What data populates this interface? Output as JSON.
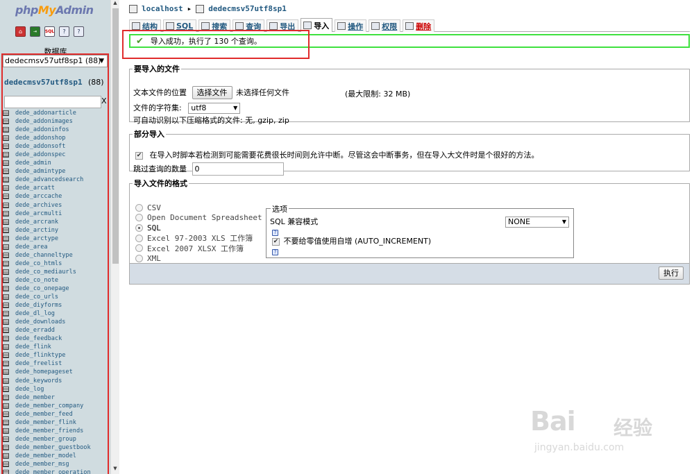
{
  "logo": {
    "php": "php",
    "my": "My",
    "admin": "Admin"
  },
  "nav_icons": [
    "home-icon",
    "sql-icon",
    "query-window-icon",
    "docs-icon",
    "mysql-docs-icon"
  ],
  "sidebar": {
    "caption": "数据库",
    "db_select_value": "dedecmsv57utf8sp1 (88)",
    "db_link": "dedecmsv57utf8sp1",
    "db_count": "(88)",
    "filter_clear": "X",
    "tables": [
      "dede_addonarticle",
      "dede_addonimages",
      "dede_addoninfos",
      "dede_addonshop",
      "dede_addonsoft",
      "dede_addonspec",
      "dede_admin",
      "dede_admintype",
      "dede_advancedsearch",
      "dede_arcatt",
      "dede_arccache",
      "dede_archives",
      "dede_arcmulti",
      "dede_arcrank",
      "dede_arctiny",
      "dede_arctype",
      "dede_area",
      "dede_channeltype",
      "dede_co_htmls",
      "dede_co_mediaurls",
      "dede_co_note",
      "dede_co_onepage",
      "dede_co_urls",
      "dede_diyforms",
      "dede_dl_log",
      "dede_downloads",
      "dede_erradd",
      "dede_feedback",
      "dede_flink",
      "dede_flinktype",
      "dede_freelist",
      "dede_homepageset",
      "dede_keywords",
      "dede_log",
      "dede_member",
      "dede_member_company",
      "dede_member_feed",
      "dede_member_flink",
      "dede_member_friends",
      "dede_member_group",
      "dede_member_guestbook",
      "dede_member_model",
      "dede_member_msg",
      "dede_member_operation"
    ]
  },
  "breadcrumb": {
    "server": "localhost",
    "separator": "▸",
    "database": "dedecmsv57utf8sp1"
  },
  "tabs": [
    {
      "label": "结构",
      "icon": "structure-icon"
    },
    {
      "label": "SQL",
      "icon": "sql-icon"
    },
    {
      "label": "搜索",
      "icon": "search-icon"
    },
    {
      "label": "查询",
      "icon": "query-icon"
    },
    {
      "label": "导出",
      "icon": "export-icon"
    },
    {
      "label": "导入",
      "icon": "import-icon",
      "active": true
    },
    {
      "label": "操作",
      "icon": "operations-icon"
    },
    {
      "label": "权限",
      "icon": "privileges-icon"
    },
    {
      "label": "删除",
      "icon": "drop-icon"
    }
  ],
  "success_message": "导入成功，执行了 130 个查询。",
  "file_section": {
    "legend": "要导入的文件",
    "location_label": "文本文件的位置",
    "choose_button": "选择文件",
    "no_file": "未选择任何文件",
    "max_limit": "(最大限制: 32 MB)",
    "charset_label": "文件的字符集:",
    "charset_value": "utf8",
    "compression_note": "可自动识别以下压缩格式的文件: 无, gzip, zip"
  },
  "partial_section": {
    "legend": "部分导入",
    "allow_interrupt_label": "在导入时脚本若检测到可能需要花费很长时间则允许中断。尽管这会中断事务，但在导入大文件时是个很好的方法。",
    "allow_interrupt_checked": true,
    "skip_label": "跳过查询的数量",
    "skip_value": "0"
  },
  "format_section": {
    "legend": "导入文件的格式",
    "formats": [
      {
        "label": "CSV",
        "selected": false
      },
      {
        "label": "Open Document Spreadsheet",
        "selected": false
      },
      {
        "label": "SQL",
        "selected": true
      },
      {
        "label": "Excel 97-2003 XLS 工作簿",
        "selected": false
      },
      {
        "label": "Excel 2007 XLSX 工作簿",
        "selected": false
      },
      {
        "label": "XML",
        "selected": false
      }
    ],
    "options": {
      "legend": "选项",
      "compat_label": "SQL 兼容模式",
      "compat_value": "NONE",
      "no_auto_value_label": "不要给零值使用自增 (AUTO_INCREMENT)",
      "no_auto_value_checked": true
    }
  },
  "submit_button": "执行",
  "watermark": {
    "text": "Bai",
    "cn": "经验",
    "url": "jingyan.baidu.com"
  },
  "colors": {
    "accent_link": "#235a81",
    "success_border": "#3ee13e",
    "highlight_box": "#e02b2b",
    "sidebar_bg": "#d0dce0"
  }
}
